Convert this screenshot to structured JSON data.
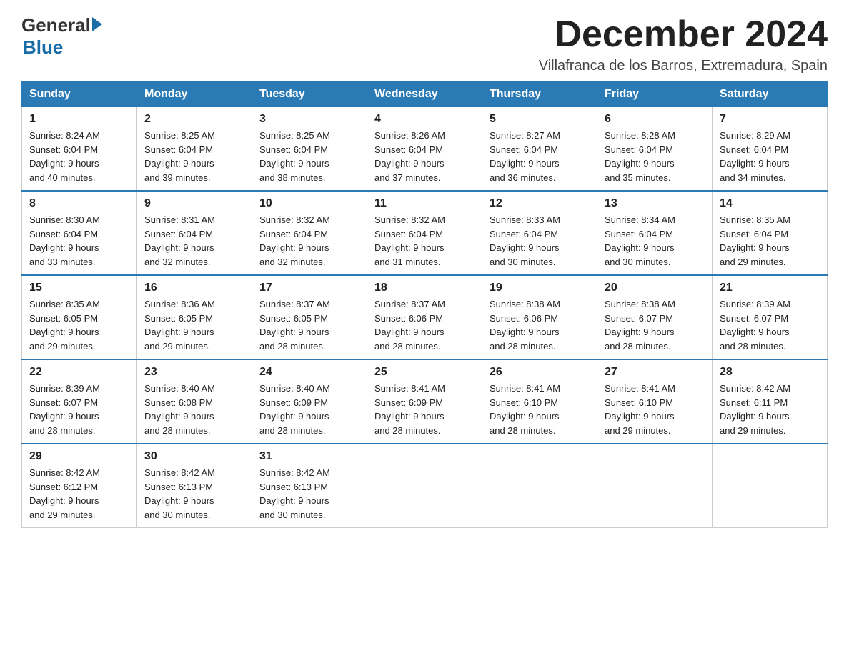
{
  "header": {
    "month_title": "December 2024",
    "location": "Villafranca de los Barros, Extremadura, Spain",
    "logo_general": "General",
    "logo_blue": "Blue"
  },
  "days_of_week": [
    "Sunday",
    "Monday",
    "Tuesday",
    "Wednesday",
    "Thursday",
    "Friday",
    "Saturday"
  ],
  "weeks": [
    [
      {
        "day": "1",
        "sunrise": "8:24 AM",
        "sunset": "6:04 PM",
        "daylight_h": "9 hours",
        "daylight_m": "and 40 minutes."
      },
      {
        "day": "2",
        "sunrise": "8:25 AM",
        "sunset": "6:04 PM",
        "daylight_h": "9 hours",
        "daylight_m": "and 39 minutes."
      },
      {
        "day": "3",
        "sunrise": "8:25 AM",
        "sunset": "6:04 PM",
        "daylight_h": "9 hours",
        "daylight_m": "and 38 minutes."
      },
      {
        "day": "4",
        "sunrise": "8:26 AM",
        "sunset": "6:04 PM",
        "daylight_h": "9 hours",
        "daylight_m": "and 37 minutes."
      },
      {
        "day": "5",
        "sunrise": "8:27 AM",
        "sunset": "6:04 PM",
        "daylight_h": "9 hours",
        "daylight_m": "and 36 minutes."
      },
      {
        "day": "6",
        "sunrise": "8:28 AM",
        "sunset": "6:04 PM",
        "daylight_h": "9 hours",
        "daylight_m": "and 35 minutes."
      },
      {
        "day": "7",
        "sunrise": "8:29 AM",
        "sunset": "6:04 PM",
        "daylight_h": "9 hours",
        "daylight_m": "and 34 minutes."
      }
    ],
    [
      {
        "day": "8",
        "sunrise": "8:30 AM",
        "sunset": "6:04 PM",
        "daylight_h": "9 hours",
        "daylight_m": "and 33 minutes."
      },
      {
        "day": "9",
        "sunrise": "8:31 AM",
        "sunset": "6:04 PM",
        "daylight_h": "9 hours",
        "daylight_m": "and 32 minutes."
      },
      {
        "day": "10",
        "sunrise": "8:32 AM",
        "sunset": "6:04 PM",
        "daylight_h": "9 hours",
        "daylight_m": "and 32 minutes."
      },
      {
        "day": "11",
        "sunrise": "8:32 AM",
        "sunset": "6:04 PM",
        "daylight_h": "9 hours",
        "daylight_m": "and 31 minutes."
      },
      {
        "day": "12",
        "sunrise": "8:33 AM",
        "sunset": "6:04 PM",
        "daylight_h": "9 hours",
        "daylight_m": "and 30 minutes."
      },
      {
        "day": "13",
        "sunrise": "8:34 AM",
        "sunset": "6:04 PM",
        "daylight_h": "9 hours",
        "daylight_m": "and 30 minutes."
      },
      {
        "day": "14",
        "sunrise": "8:35 AM",
        "sunset": "6:04 PM",
        "daylight_h": "9 hours",
        "daylight_m": "and 29 minutes."
      }
    ],
    [
      {
        "day": "15",
        "sunrise": "8:35 AM",
        "sunset": "6:05 PM",
        "daylight_h": "9 hours",
        "daylight_m": "and 29 minutes."
      },
      {
        "day": "16",
        "sunrise": "8:36 AM",
        "sunset": "6:05 PM",
        "daylight_h": "9 hours",
        "daylight_m": "and 29 minutes."
      },
      {
        "day": "17",
        "sunrise": "8:37 AM",
        "sunset": "6:05 PM",
        "daylight_h": "9 hours",
        "daylight_m": "and 28 minutes."
      },
      {
        "day": "18",
        "sunrise": "8:37 AM",
        "sunset": "6:06 PM",
        "daylight_h": "9 hours",
        "daylight_m": "and 28 minutes."
      },
      {
        "day": "19",
        "sunrise": "8:38 AM",
        "sunset": "6:06 PM",
        "daylight_h": "9 hours",
        "daylight_m": "and 28 minutes."
      },
      {
        "day": "20",
        "sunrise": "8:38 AM",
        "sunset": "6:07 PM",
        "daylight_h": "9 hours",
        "daylight_m": "and 28 minutes."
      },
      {
        "day": "21",
        "sunrise": "8:39 AM",
        "sunset": "6:07 PM",
        "daylight_h": "9 hours",
        "daylight_m": "and 28 minutes."
      }
    ],
    [
      {
        "day": "22",
        "sunrise": "8:39 AM",
        "sunset": "6:07 PM",
        "daylight_h": "9 hours",
        "daylight_m": "and 28 minutes."
      },
      {
        "day": "23",
        "sunrise": "8:40 AM",
        "sunset": "6:08 PM",
        "daylight_h": "9 hours",
        "daylight_m": "and 28 minutes."
      },
      {
        "day": "24",
        "sunrise": "8:40 AM",
        "sunset": "6:09 PM",
        "daylight_h": "9 hours",
        "daylight_m": "and 28 minutes."
      },
      {
        "day": "25",
        "sunrise": "8:41 AM",
        "sunset": "6:09 PM",
        "daylight_h": "9 hours",
        "daylight_m": "and 28 minutes."
      },
      {
        "day": "26",
        "sunrise": "8:41 AM",
        "sunset": "6:10 PM",
        "daylight_h": "9 hours",
        "daylight_m": "and 28 minutes."
      },
      {
        "day": "27",
        "sunrise": "8:41 AM",
        "sunset": "6:10 PM",
        "daylight_h": "9 hours",
        "daylight_m": "and 29 minutes."
      },
      {
        "day": "28",
        "sunrise": "8:42 AM",
        "sunset": "6:11 PM",
        "daylight_h": "9 hours",
        "daylight_m": "and 29 minutes."
      }
    ],
    [
      {
        "day": "29",
        "sunrise": "8:42 AM",
        "sunset": "6:12 PM",
        "daylight_h": "9 hours",
        "daylight_m": "and 29 minutes."
      },
      {
        "day": "30",
        "sunrise": "8:42 AM",
        "sunset": "6:13 PM",
        "daylight_h": "9 hours",
        "daylight_m": "and 30 minutes."
      },
      {
        "day": "31",
        "sunrise": "8:42 AM",
        "sunset": "6:13 PM",
        "daylight_h": "9 hours",
        "daylight_m": "and 30 minutes."
      },
      null,
      null,
      null,
      null
    ]
  ],
  "labels": {
    "sunrise": "Sunrise:",
    "sunset": "Sunset:",
    "daylight": "Daylight:"
  }
}
